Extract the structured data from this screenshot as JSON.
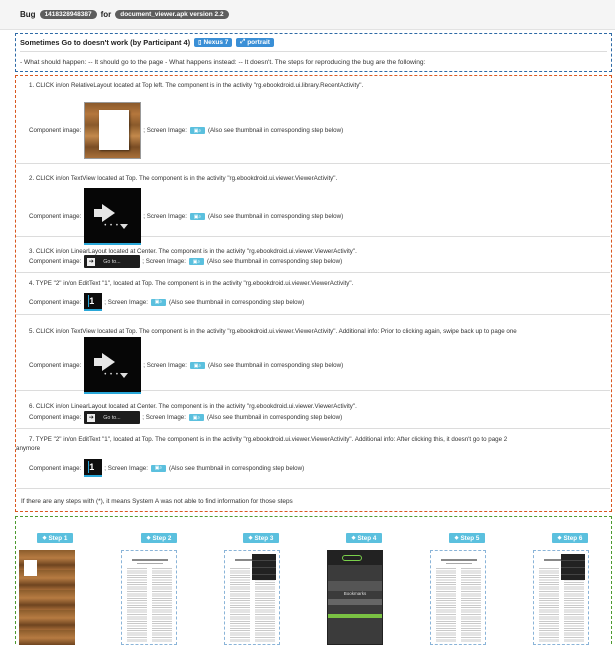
{
  "header": {
    "bug_label": "Bug",
    "bug_id": "1418328948387",
    "for_label": "for",
    "app_version": "document_viewer.apk version 2.2"
  },
  "report": {
    "title": "Sometimes Go to doesn't work (by Participant 4)",
    "device": "Nexus 7",
    "orientation": "portrait",
    "description": "- What should happen: -- It should go to the page - What happens instead: -- It doesn't. The steps for reproducing the bug are the following:"
  },
  "labels": {
    "component_image": "Component image:",
    "screen_image": "; Screen Image:",
    "see_thumbnail": "(Also see thumbnail in corresponding step below)"
  },
  "steps": [
    {
      "text": "1. CLICK in/on RelativeLayout located at Top left. The component is in the activity \"rg.ebookdroid.ui.library.RecentActivity\".",
      "image": "bookshelf"
    },
    {
      "text": "2. CLICK in/on TextView located at Top. The component is in the activity \"rg.ebookdroid.ui.viewer.ViewerActivity\".",
      "image": "arrow"
    },
    {
      "text": "3. CLICK in/on LinearLayout located at Center. The component is in the activity \"rg.ebookdroid.ui.viewer.ViewerActivity\".",
      "image": "goto"
    },
    {
      "text": "4. TYPE \"2\" in/on EditText \"1\", located at Top. The component is in the activity \"rg.ebookdroid.ui.viewer.ViewerActivity\".",
      "image": "edit"
    },
    {
      "text": "5. CLICK in/on TextView located at Top. The component is in the activity \"rg.ebookdroid.ui.viewer.ViewerActivity\". Additional info: Prior to clicking again, swipe back up to page one",
      "image": "arrow"
    },
    {
      "text": "6. CLICK in/on LinearLayout located at Center. The component is in the activity \"rg.ebookdroid.ui.viewer.ViewerActivity\".",
      "image": "goto"
    },
    {
      "text": "7. TYPE \"2\" in/on EditText \"1\", located at Top. The component is in the activity \"rg.ebookdroid.ui.viewer.ViewerActivity\". Additional info: After clicking this, it doesn't go to page 2",
      "text2": "anymore",
      "image": "edit"
    }
  ],
  "goto_text": "Go to...",
  "edit_value": "1",
  "footer_note": "If there are any steps with (*), it means System A was not able to find information for those steps",
  "thumbnails": {
    "tabs": [
      "Step 1",
      "Step 2",
      "Step 3",
      "Step 4",
      "Step 5",
      "Step 6"
    ],
    "step4_caption": "Bookmarks"
  },
  "colors": {
    "blue_border": "#2e6aa6",
    "orange_border": "#d9571f",
    "green_border": "#4d9a2f",
    "tag_blue": "#3a8fd6",
    "step_tab": "#5bc0de"
  },
  "icons": {
    "device": "tablet-icon",
    "orientation": "expand-icon",
    "screen": "image-search-icon",
    "step_tab": "tag-icon"
  }
}
